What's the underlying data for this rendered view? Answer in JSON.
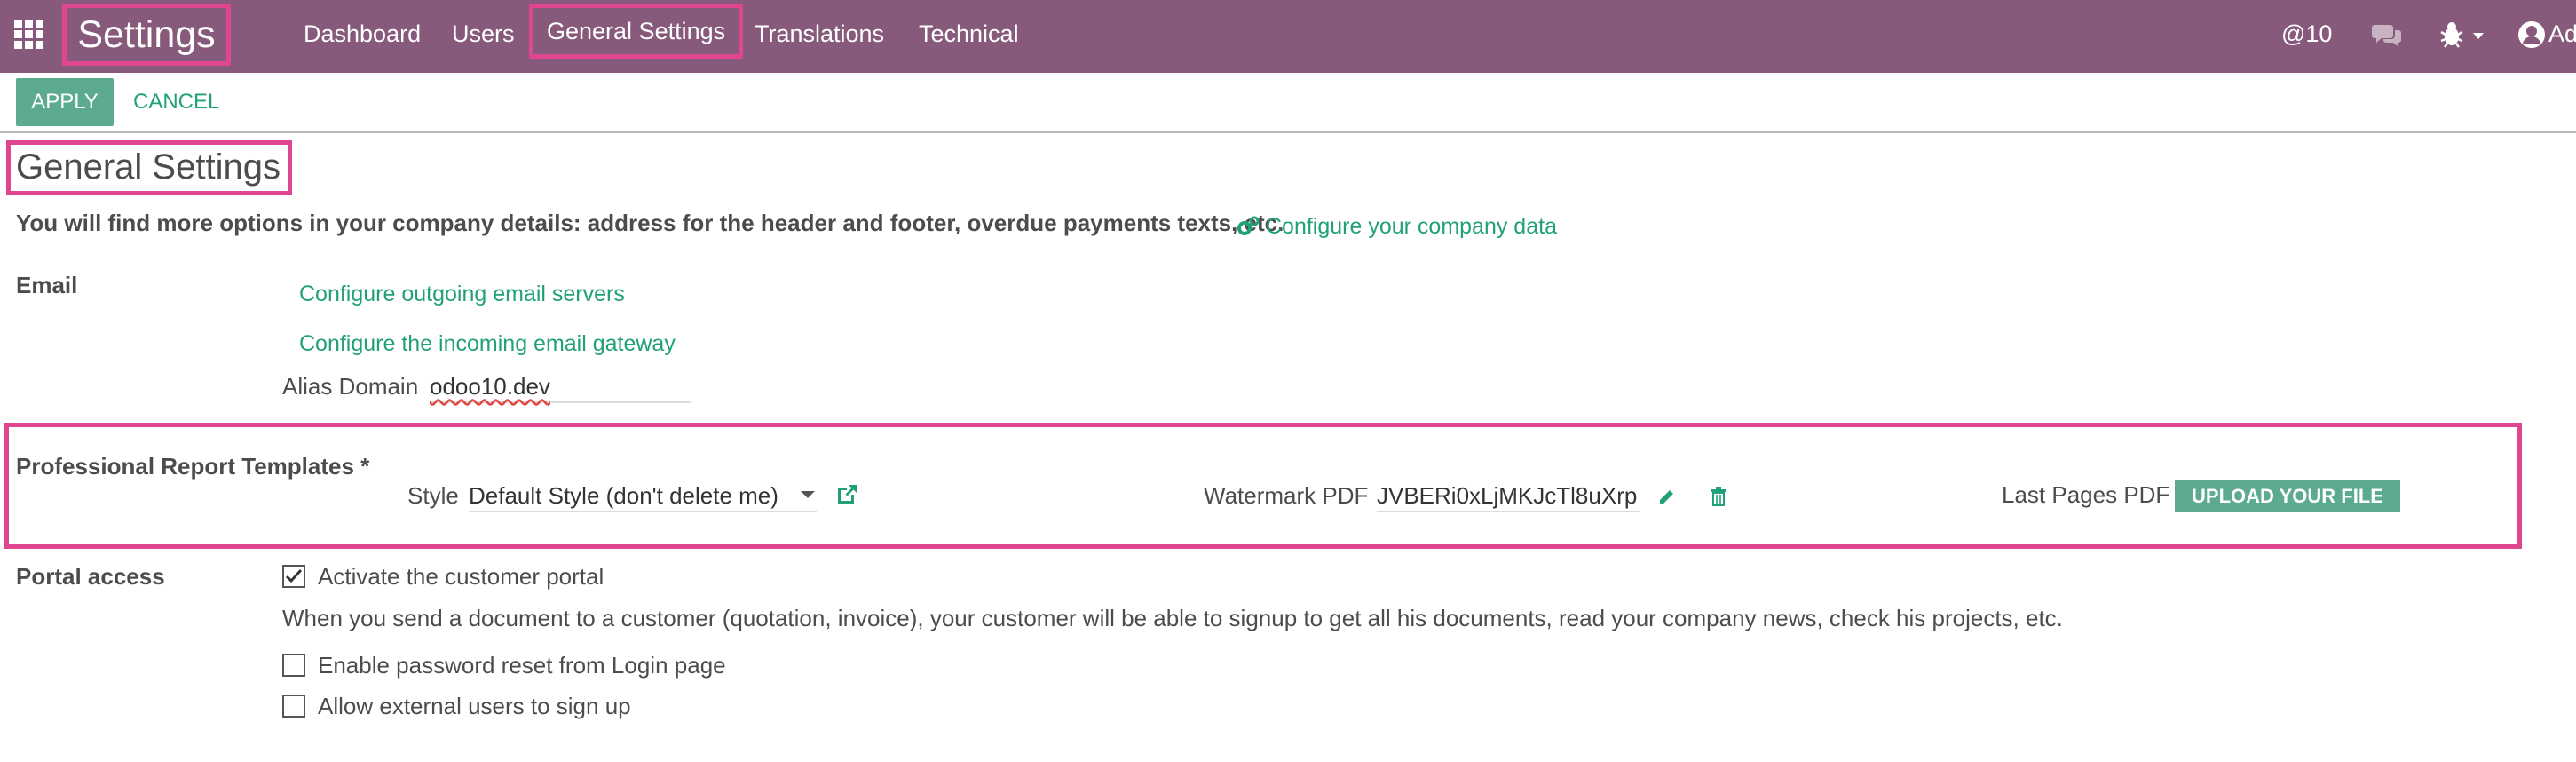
{
  "navbar": {
    "app_title": "Settings",
    "menu": [
      "Dashboard",
      "Users",
      "General Settings",
      "Translations",
      "Technical"
    ],
    "mentions_label": "@10",
    "user_label": "Ad"
  },
  "control_panel": {
    "apply_label": "APPLY",
    "cancel_label": "CANCEL"
  },
  "page": {
    "title": "General Settings",
    "intro": "You will find more options in your company details: address for the header and footer, overdue payments texts, etc.",
    "configure_company_link": "Configure your company data"
  },
  "email": {
    "label": "Email",
    "outgoing_link": "Configure outgoing email servers",
    "incoming_link": "Configure the incoming email gateway",
    "alias_domain_label": "Alias Domain",
    "alias_domain_value": "odoo10.dev"
  },
  "report": {
    "label": "Professional Report Templates *",
    "style_label": "Style",
    "style_value": "Default Style (don't delete me)",
    "watermark_label": "Watermark PDF",
    "watermark_value": "JVBERi0xLjMKJcTl8uXrp",
    "last_pages_label": "Last Pages PDF",
    "upload_label": "UPLOAD YOUR FILE"
  },
  "portal": {
    "label": "Portal access",
    "activate_label": "Activate the customer portal",
    "activate_checked": true,
    "description": "When you send a document to a customer (quotation, invoice), your customer will be able to signup to get all his documents, read your company news, check his projects, etc.",
    "password_reset_label": "Enable password reset from Login page",
    "password_reset_checked": false,
    "external_signup_label": "Allow external users to sign up",
    "external_signup_checked": false
  },
  "colors": {
    "navbar": "#875a7b",
    "accent_green": "#21a07a",
    "button_green": "#5caa8f",
    "highlight_pink": "#e0458f"
  }
}
